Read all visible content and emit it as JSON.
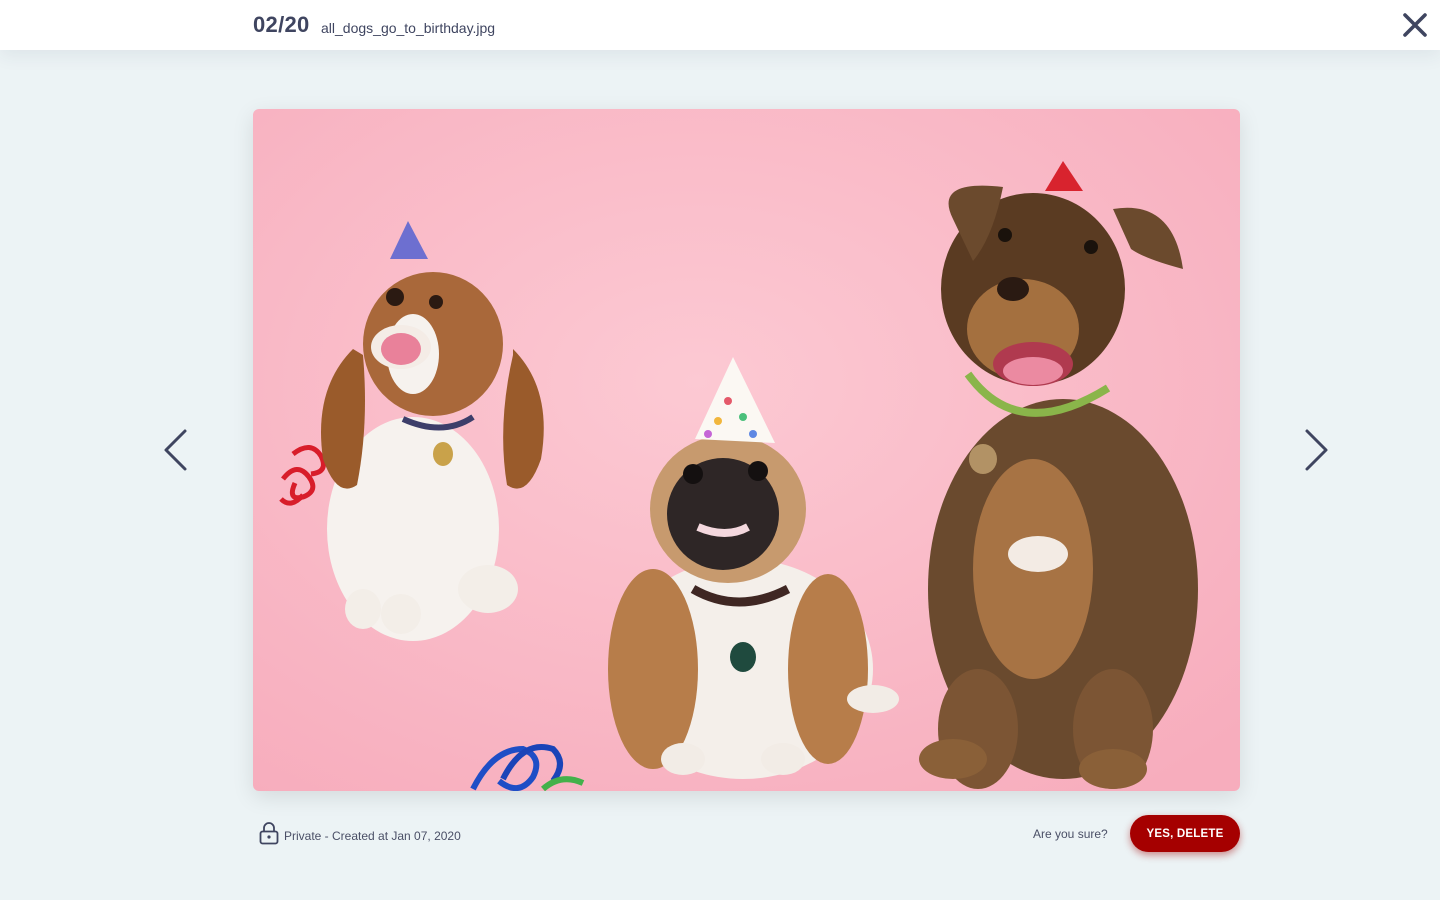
{
  "header": {
    "counter": "02/20",
    "filename": "all_dogs_go_to_birthday.jpg",
    "close_icon": "close-icon"
  },
  "navigation": {
    "prev_icon": "chevron-left-icon",
    "next_icon": "chevron-right-icon"
  },
  "photo": {
    "subject": "three dogs wearing party hats on pink background",
    "background_color": "#f9b9c6"
  },
  "footer": {
    "privacy_icon": "lock-icon",
    "meta_text": "Private -  Created at Jan 07, 2020",
    "confirm_prompt": "Are you sure?",
    "delete_label": "YES, DELETE"
  },
  "colors": {
    "accent_delete": "#a50000",
    "text_primary": "#3f4560",
    "page_background": "#ecf3f5"
  }
}
